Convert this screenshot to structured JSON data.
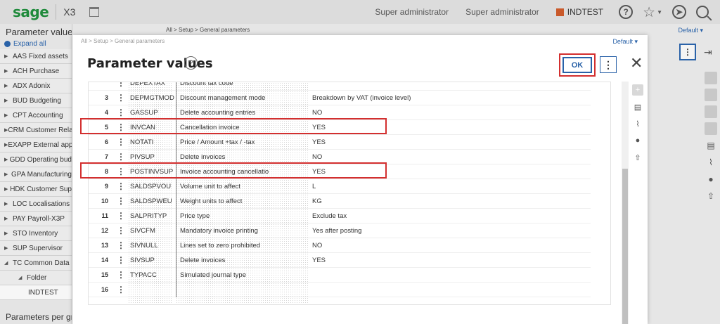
{
  "topbar": {
    "logo": "sage",
    "product": "X3",
    "user_role": "Super administrator",
    "user_name": "Super administrator",
    "folder": "INDTEST",
    "icons": [
      "calendar-icon",
      "help-icon",
      "star-icon",
      "compass-icon",
      "search-icon"
    ]
  },
  "left_panel": {
    "title": "Parameter values",
    "expand_all": "Expand all",
    "items": [
      "AAS Fixed assets",
      "ACH Purchase",
      "ADX Adonix",
      "BUD Budgeting",
      "CPT Accounting",
      "CRM Customer Rela",
      "EXAPP External app",
      "GDD Operating bud",
      "GPA Manufacturing",
      "HDK Customer Sup",
      "LOC Localisations",
      "PAY Payroll-X3P",
      "STO Inventory",
      "SUP Supervisor",
      "TC Common Data"
    ],
    "sub_item": "Folder",
    "leaf_item": "INDTEST",
    "bottom_title": "Parameters per gro"
  },
  "background": {
    "breadcrumb": [
      "All",
      "Setup",
      "General parameters"
    ],
    "default_label": "Default"
  },
  "modal": {
    "breadcrumb": [
      "All",
      "Setup",
      "General parameters"
    ],
    "default_label": "Default",
    "title": "Parameter values",
    "ok_label": "OK",
    "rows": [
      {
        "num": "",
        "code": "DEPEXTAX",
        "desc": "Discount tax code",
        "val": ""
      },
      {
        "num": "3",
        "code": "DEPMGTMOD",
        "desc": "Discount management mode",
        "val": "Breakdown by VAT (invoice level)"
      },
      {
        "num": "4",
        "code": "GASSUP",
        "desc": "Delete accounting entries",
        "val": "NO"
      },
      {
        "num": "5",
        "code": "INVCAN",
        "desc": "Cancellation invoice",
        "val": "YES"
      },
      {
        "num": "6",
        "code": "NOTATI",
        "desc": "Price / Amount +tax / -tax",
        "val": "YES"
      },
      {
        "num": "7",
        "code": "PIVSUP",
        "desc": "Delete invoices",
        "val": "NO"
      },
      {
        "num": "8",
        "code": "POSTINVSUP",
        "desc": "Invoice accounting cancellatio",
        "val": "YES"
      },
      {
        "num": "9",
        "code": "SALDSPVOU",
        "desc": "Volume unit to affect",
        "val": "L"
      },
      {
        "num": "10",
        "code": "SALDSPWEU",
        "desc": "Weight units to affect",
        "val": "KG"
      },
      {
        "num": "11",
        "code": "SALPRITYP",
        "desc": "Price type",
        "val": "Exclude tax"
      },
      {
        "num": "12",
        "code": "SIVCFM",
        "desc": "Mandatory invoice printing",
        "val": "Yes after posting"
      },
      {
        "num": "13",
        "code": "SIVNULL",
        "desc": "Lines set to zero prohibited",
        "val": "NO"
      },
      {
        "num": "14",
        "code": "SIVSUP",
        "desc": "Delete invoices",
        "val": "YES"
      },
      {
        "num": "15",
        "code": "TYPACC",
        "desc": "Simulated journal type",
        "val": ""
      },
      {
        "num": "16",
        "code": "",
        "desc": "",
        "val": ""
      }
    ]
  },
  "colors": {
    "brand_green": "#1f8a3b",
    "accent_blue": "#2a62a8",
    "highlight_red": "#d32f2f",
    "folder_orange": "#c9592a"
  }
}
